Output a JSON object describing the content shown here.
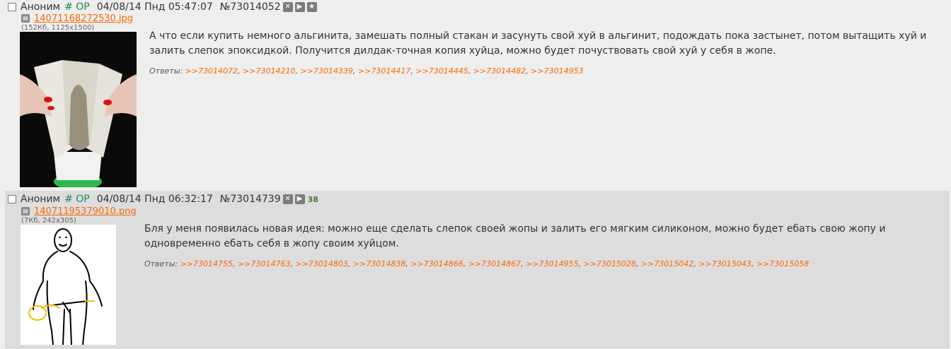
{
  "posts": [
    {
      "name": "Аноним",
      "trip": "# OP",
      "date": "04/08/14 Пнд 05:47:07",
      "number": "№73014052",
      "file_name": "14071168272530.jpg",
      "file_info": "(152Кб, 1125x1500)",
      "message": "А что если купить немного альгинита, замешать полный стакан и засунуть свой хуй в альгинит, подождать пока застынет, потом вытащить хуй и залить слепок эпоксидкой. Получится дилдак-точная копия хуйца, можно будет почуствовать свой хуй у себя в жопе.",
      "replies_label": "Ответы:",
      "replies": [
        ">>73014072",
        ">>73014210",
        ">>73014339",
        ">>73014417",
        ">>73014445",
        ">>73014482",
        ">>73014953"
      ],
      "buttons": [
        "hide-icon",
        "reply-icon",
        "favorite-icon"
      ]
    },
    {
      "name": "Аноним",
      "trip": "# OP",
      "date": "04/08/14 Пнд 06:32:17",
      "number": "№73014739",
      "counter": "38",
      "file_name": "14071195379010.png",
      "file_info": "(7Кб, 242x305)",
      "message": "Бля у меня появилась новая идея: можно еще сделать слепок своей жопы и залить его мягким силиконом, можно будет ебать свою жопу и одновременно ебать себя в жопу своим хуйцом.",
      "replies_label": "Ответы:",
      "replies": [
        ">>73014755",
        ">>73014763",
        ">>73014803",
        ">>73014838",
        ">>73014866",
        ">>73014867",
        ">>73014955",
        ">>73015028",
        ">>73015042",
        ">>73015043",
        ">>73015058"
      ],
      "buttons": [
        "hide-icon",
        "reply-icon"
      ]
    }
  ],
  "colors": {
    "link": "#ff6600",
    "trip": "#228854",
    "background": "#eeeeee",
    "reply_bg": "#dddddd"
  }
}
